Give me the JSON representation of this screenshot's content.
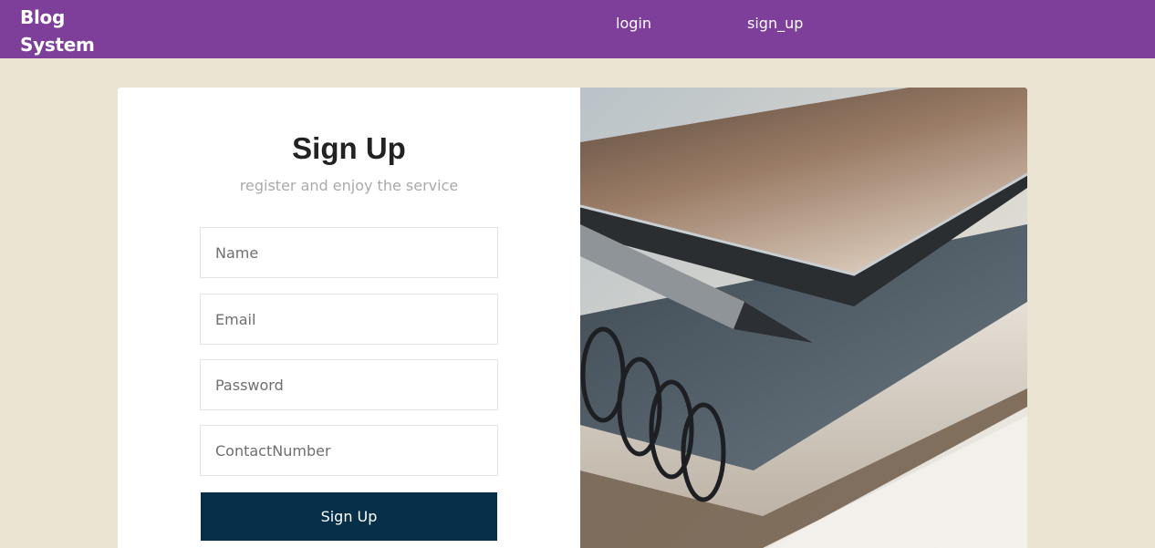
{
  "navbar": {
    "brand": "Blog System",
    "links": [
      {
        "label": "login"
      },
      {
        "label": "sign_up"
      }
    ]
  },
  "signup": {
    "title": "Sign Up",
    "subtitle": "register and enjoy the service",
    "fields": {
      "name": {
        "placeholder": "Name",
        "value": ""
      },
      "email": {
        "placeholder": "Email",
        "value": ""
      },
      "password": {
        "placeholder": "Password",
        "value": ""
      },
      "contact": {
        "placeholder": "ContactNumber",
        "value": ""
      }
    },
    "submit_label": "Sign Up"
  },
  "hero_image": {
    "subject": "notebook-phone-pencil-photo"
  },
  "colors": {
    "navbar": "#7d3f9a",
    "page_background": "#ebe4d3",
    "button": "#06304a"
  }
}
